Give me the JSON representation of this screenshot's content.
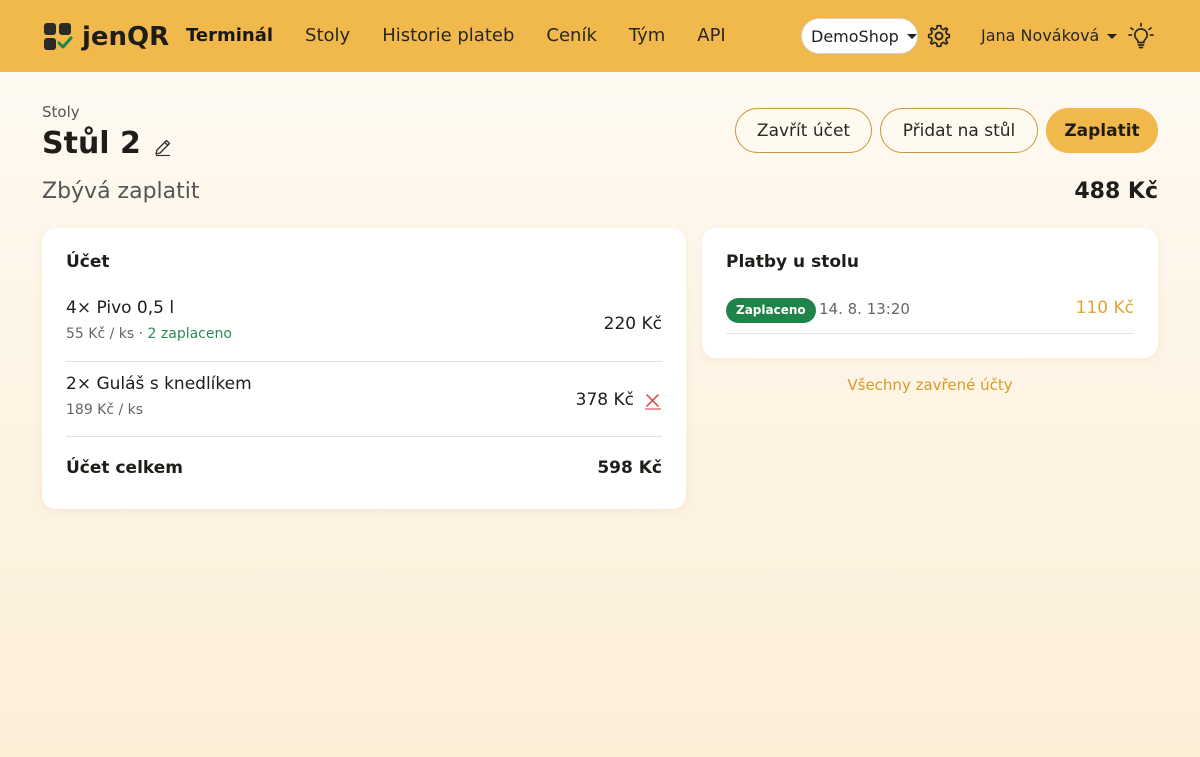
{
  "header": {
    "brand": "jenQR",
    "nav": [
      {
        "label": "Terminál",
        "active": true
      },
      {
        "label": "Stoly",
        "active": false
      },
      {
        "label": "Historie plateb",
        "active": false
      },
      {
        "label": "Ceník",
        "active": false
      },
      {
        "label": "Tým",
        "active": false
      },
      {
        "label": "API",
        "active": false
      }
    ],
    "shop_select": "DemoShop",
    "user_name": "Jana Nováková"
  },
  "page": {
    "breadcrumb": "Stoly",
    "title": "Stůl 2",
    "actions": {
      "close": "Zavřít účet",
      "add": "Přidat na stůl",
      "pay": "Zaplatit"
    },
    "remaining_label": "Zbývá zaplatit",
    "remaining_value": "488 Kč"
  },
  "bill": {
    "title": "Účet",
    "items": [
      {
        "name": "4× Pivo 0,5 l",
        "unit": "55 Kč / ks",
        "separator": " · ",
        "paid": "2 zaplaceno",
        "price": "220 Kč"
      },
      {
        "name": "2× Guláš s knedlíkem",
        "unit": "189 Kč / ks",
        "price": "378 Kč"
      }
    ],
    "total_label": "Účet celkem",
    "total_value": "598 Kč"
  },
  "payments": {
    "title": "Platby u stolu",
    "rows": [
      {
        "status": "Zaplaceno",
        "time": "14. 8. 13:20",
        "amount": "110 Kč"
      }
    ],
    "all_closed_link": "Všechny zavřené účty"
  },
  "colors": {
    "accent": "#f1b84b",
    "paid_badge": "#1e8449",
    "paid_text": "#2e8b57",
    "remove": "#d9534f",
    "amount": "#e5a432"
  },
  "icons": [
    "logo-icon",
    "gear-icon",
    "chevron-down-icon",
    "lightbulb-icon",
    "pencil-icon",
    "close-icon"
  ]
}
